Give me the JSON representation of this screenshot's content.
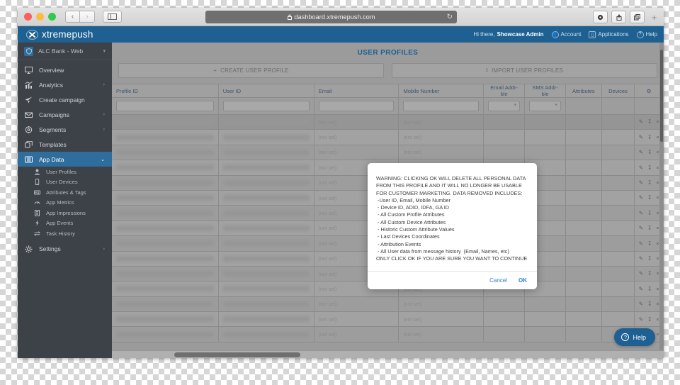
{
  "browser": {
    "url": "dashboard.xtremepush.com",
    "lock_icon": "lock-icon",
    "back_label": "‹",
    "forward_label": "›",
    "reload_label": "↻",
    "new_tab_label": "+"
  },
  "header": {
    "brand": "xtremepush",
    "greeting_prefix": "Hi there,",
    "user": "Showcase Admin",
    "account_label": "Account",
    "applications_label": "Applications",
    "help_label": "Help"
  },
  "sidebar": {
    "account": "ALC Bank - Web",
    "items": [
      {
        "label": "Overview",
        "icon": "monitor-icon",
        "chevron": ""
      },
      {
        "label": "Analytics",
        "icon": "bar-chart-icon",
        "chevron": "›"
      },
      {
        "label": "Create campaign",
        "icon": "paper-plane-icon",
        "chevron": ""
      },
      {
        "label": "Campaigns",
        "icon": "envelope-icon",
        "chevron": "›"
      },
      {
        "label": "Segments",
        "icon": "target-icon",
        "chevron": "›"
      },
      {
        "label": "Templates",
        "icon": "layers-icon",
        "chevron": ""
      },
      {
        "label": "App Data",
        "icon": "database-icon",
        "chevron": "⌄"
      }
    ],
    "subitems": [
      {
        "label": "User Profiles",
        "icon": "user-icon"
      },
      {
        "label": "User Devices",
        "icon": "mobile-icon"
      },
      {
        "label": "Attributes & Tags",
        "icon": "tag-icon"
      },
      {
        "label": "App Metrics",
        "icon": "gauge-icon"
      },
      {
        "label": "App Impressions",
        "icon": "document-icon"
      },
      {
        "label": "App Events",
        "icon": "bolt-icon"
      },
      {
        "label": "Task History",
        "icon": "exchange-icon"
      }
    ],
    "settings": {
      "label": "Settings",
      "icon": "gear-icon",
      "chevron": "›"
    }
  },
  "main": {
    "title": "USER PROFILES",
    "create_button": "CREATE USER PROFILE",
    "create_icon": "plus-icon",
    "import_button": "IMPORT USER PROFILES",
    "import_icon": "upload-icon",
    "columns": [
      "Profile ID",
      "User ID",
      "Email",
      "Mobile Number",
      "Email Addr-ble",
      "SMS Addr-ble",
      "Attributes",
      "Devices"
    ],
    "settings_column_icon": "gear-icon",
    "not_set_text": "(not set)",
    "row_actions": {
      "edit_icon": "pencil-icon",
      "export_icon": "download-icon",
      "delete_icon": "close-icon"
    },
    "row_count": 15
  },
  "dialog": {
    "lines": [
      "WARNING: CLICKING OK WILL DELETE ALL PERSONAL DATA",
      "FROM THIS PROFILE AND IT WILL NO LONGER BE USABLE",
      "FOR CUSTOMER MARKETING. DATA REMOVED INCLUDES:",
      " -User ID, Email, Mobile Number",
      " - Device ID, ADID, IDFA, GA ID",
      " - All Custom Profile Attributes",
      " - All Custom Device Attributes",
      " - Historic Custom Attribute Values",
      " - Last Devices Coordinates",
      " - Attribution Events",
      " - All User data from message history  (Email, Names, etc)",
      "ONLY CLICK OK IF YOU ARE SURE YOU WANT TO CONTINUE"
    ],
    "cancel_label": "Cancel",
    "ok_label": "OK"
  },
  "help_widget": {
    "label": "Help",
    "icon": "question-icon"
  },
  "colors": {
    "brand_blue": "#1d6091",
    "sidebar_bg": "#3d4148",
    "active_blue": "#2f6d9c",
    "dialog_link": "#2a7fd4"
  }
}
